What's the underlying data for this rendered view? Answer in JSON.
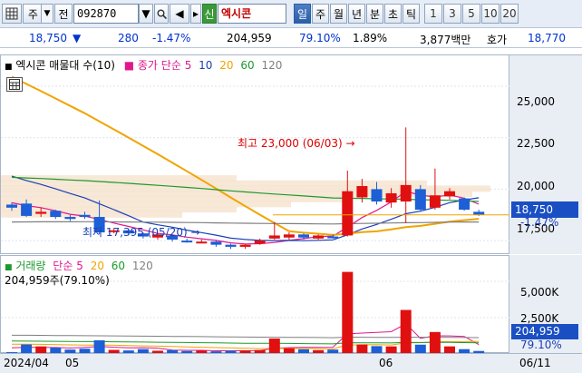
{
  "toolbar": {
    "market_label": "주",
    "search_label": "전",
    "code_value": "092870",
    "stock_name": "엑시콘",
    "credit_badge": "신",
    "periods": [
      "일",
      "주",
      "월",
      "년",
      "분",
      "초",
      "틱"
    ],
    "active_period": "일",
    "intervals": [
      "1",
      "3",
      "5",
      "10",
      "20"
    ]
  },
  "quote": {
    "price": "18,750",
    "change": "280",
    "change_pct": "-1.47%",
    "volume": "204,959",
    "volume_ratio": "79.10%",
    "turnover": "1.89%",
    "amount": "3,877백만",
    "ask_label": "호가",
    "ask_value": "18,770"
  },
  "price_chart": {
    "legend_title": "엑시콘 매물대 수(10)",
    "legend_ma": "종가 단순",
    "ma_periods": [
      "5",
      "10",
      "20",
      "60",
      "120"
    ],
    "ma_colors": [
      "#e0188e",
      "#1a3fb5",
      "#f0a400",
      "#1c9a2c",
      "#7f7f7f"
    ],
    "axis_ticks": [
      "25,000",
      "22,500",
      "20,000",
      "17,500"
    ],
    "current_price": "18,750",
    "current_pct": "-1.47%",
    "high_annotation": "최고 23,000 (06/03) →",
    "low_annotation": "최저 17,395 (05/20) →"
  },
  "volume_chart": {
    "legend_title": "거래량",
    "legend_ma": "단순",
    "ma_periods": [
      "5",
      "20",
      "60",
      "120"
    ],
    "sub_label": "204,959주(79.10%)",
    "axis_ticks": [
      "5,000K",
      "2,500K"
    ],
    "current_volume": "204,959",
    "current_pct": "79.10%"
  },
  "date_axis": [
    "2024/04",
    "05",
    "06",
    "06/11"
  ],
  "chart_data": {
    "type": "candlestick",
    "ylim": [
      16800,
      26500
    ],
    "candles": [
      {
        "o": 19250,
        "c": 19100,
        "h": 19350,
        "l": 18950
      },
      {
        "o": 19300,
        "c": 18700,
        "h": 19500,
        "l": 18650
      },
      {
        "o": 18800,
        "c": 18900,
        "h": 19100,
        "l": 18650
      },
      {
        "o": 18950,
        "c": 18650,
        "h": 19000,
        "l": 18550
      },
      {
        "o": 18650,
        "c": 18550,
        "h": 18750,
        "l": 18450
      },
      {
        "o": 18750,
        "c": 18650,
        "h": 18900,
        "l": 18550
      },
      {
        "o": 18650,
        "c": 17900,
        "h": 19450,
        "l": 17800
      },
      {
        "o": 17950,
        "c": 18000,
        "h": 18100,
        "l": 17850
      },
      {
        "o": 18000,
        "c": 17850,
        "h": 18050,
        "l": 17750
      },
      {
        "o": 17850,
        "c": 17700,
        "h": 17900,
        "l": 17600
      },
      {
        "o": 17650,
        "c": 17800,
        "h": 17850,
        "l": 17550
      },
      {
        "o": 17750,
        "c": 17550,
        "h": 17800,
        "l": 17450
      },
      {
        "o": 17500,
        "c": 17450,
        "h": 17600,
        "l": 17400
      },
      {
        "o": 17450,
        "c": 17450,
        "h": 17550,
        "l": 17400
      },
      {
        "o": 17450,
        "c": 17300,
        "h": 17500,
        "l": 17200
      },
      {
        "o": 17300,
        "c": 17200,
        "h": 17350,
        "l": 17100
      },
      {
        "o": 17200,
        "c": 17300,
        "h": 17350,
        "l": 17100
      },
      {
        "o": 17350,
        "c": 17500,
        "h": 17600,
        "l": 17300
      },
      {
        "o": 17600,
        "c": 17750,
        "h": 18400,
        "l": 17550
      },
      {
        "o": 17650,
        "c": 17800,
        "h": 17900,
        "l": 17550
      },
      {
        "o": 17800,
        "c": 17650,
        "h": 17850,
        "l": 17550
      },
      {
        "o": 17600,
        "c": 17750,
        "h": 17800,
        "l": 17550
      },
      {
        "o": 17700,
        "c": 17650,
        "h": 17800,
        "l": 17600
      },
      {
        "o": 17750,
        "c": 19900,
        "h": 20900,
        "l": 17700
      },
      {
        "o": 19600,
        "c": 20150,
        "h": 20500,
        "l": 19350
      },
      {
        "o": 20000,
        "c": 19400,
        "h": 20350,
        "l": 19250
      },
      {
        "o": 19350,
        "c": 19800,
        "h": 20050,
        "l": 19100
      },
      {
        "o": 19400,
        "c": 20200,
        "h": 23000,
        "l": 18350
      },
      {
        "o": 20000,
        "c": 19000,
        "h": 20200,
        "l": 18900
      },
      {
        "o": 19100,
        "c": 19700,
        "h": 21000,
        "l": 19000
      },
      {
        "o": 19650,
        "c": 19900,
        "h": 20050,
        "l": 19500
      },
      {
        "o": 19550,
        "c": 19000,
        "h": 19600,
        "l": 18950
      },
      {
        "o": 18900,
        "c": 18750,
        "h": 19000,
        "l": 18700
      }
    ],
    "volumes_k": [
      120,
      650,
      520,
      430,
      300,
      360,
      940,
      280,
      240,
      330,
      220,
      260,
      200,
      230,
      180,
      220,
      250,
      270,
      1060,
      380,
      320,
      260,
      300,
      5650,
      650,
      540,
      520,
      3030,
      640,
      1510,
      520,
      330,
      205
    ],
    "vol_ylim": [
      0,
      6500
    ]
  }
}
